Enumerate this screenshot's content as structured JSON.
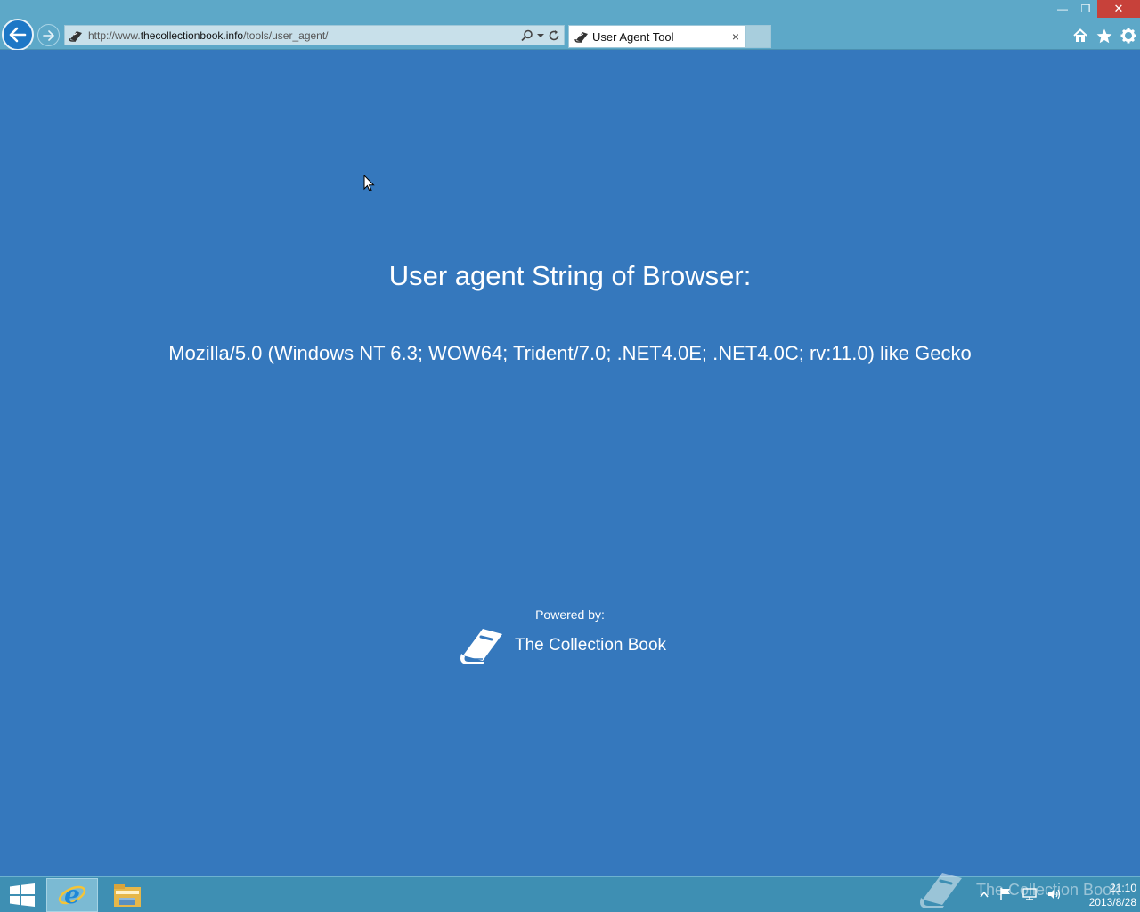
{
  "browser": {
    "url_prefix": "http://www.",
    "url_domain": "thecollectionbook.info",
    "url_path": "/tools/user_agent/",
    "tab_title": "User Agent Tool",
    "tab_close": "×"
  },
  "window_controls": {
    "minimize": "—",
    "restore": "❐",
    "close": "✕"
  },
  "page": {
    "heading": "User agent String of Browser:",
    "user_agent": "Mozilla/5.0 (Windows NT 6.3; WOW64; Trident/7.0; .NET4.0E; .NET4.0C; rv:11.0) like Gecko",
    "powered_by_label": "Powered by:",
    "brand_name": "The Collection Book"
  },
  "taskbar": {
    "watermark_text": "The Collection Book",
    "time": "21:10",
    "date": "2013/8/28"
  },
  "colors": {
    "page_background": "#3578bd",
    "chrome_background": "#5da8c8",
    "taskbar_background": "#3e8fb3",
    "close_button": "#c7413a"
  }
}
